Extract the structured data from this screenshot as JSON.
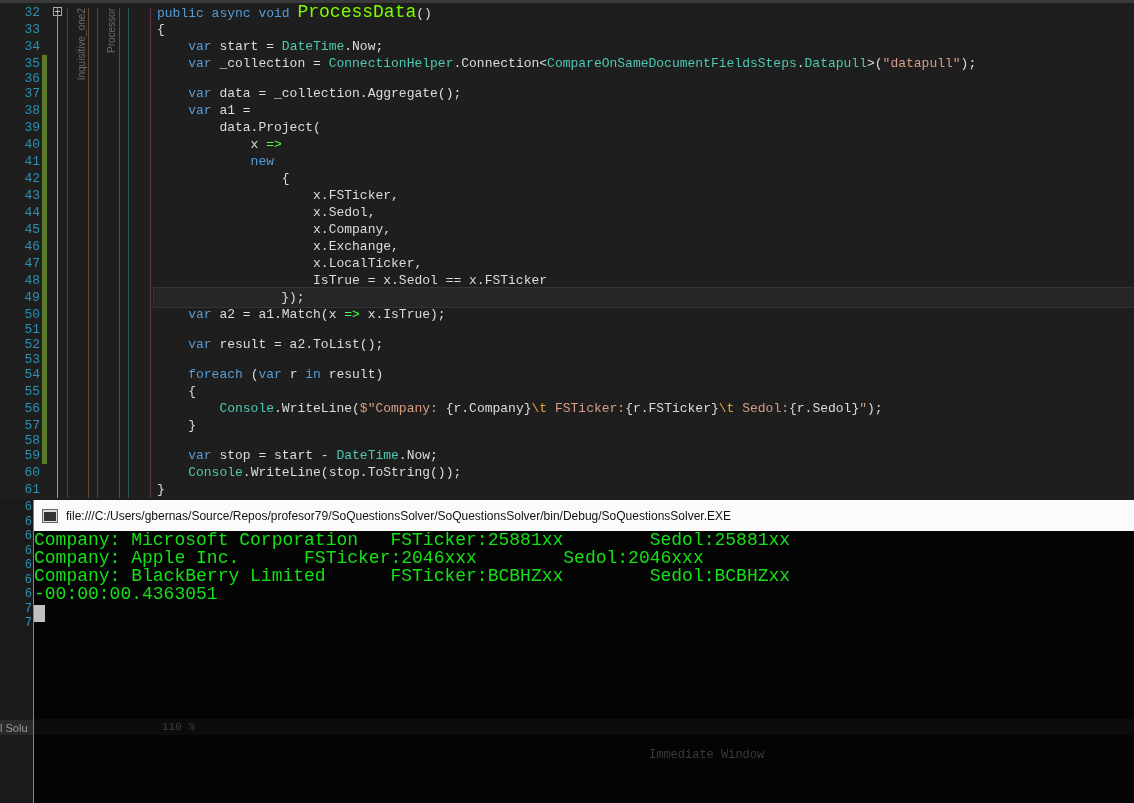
{
  "editor": {
    "margin_labels": [
      "Inquisitive_one2",
      "Processor"
    ],
    "lines": [
      {
        "number": "32",
        "changed": false,
        "current": false,
        "tokens": [
          {
            "kind": "kw",
            "text": "public async void "
          },
          {
            "kind": "method",
            "text": "ProcessData"
          },
          {
            "kind": "plain",
            "text": "()"
          }
        ]
      },
      {
        "number": "33",
        "changed": false,
        "current": false,
        "tokens": [
          {
            "kind": "plain",
            "text": "{"
          }
        ]
      },
      {
        "number": "34",
        "changed": false,
        "current": false,
        "tokens": [
          {
            "kind": "kw",
            "text": "    var"
          },
          {
            "kind": "plain",
            "text": " start = "
          },
          {
            "kind": "type",
            "text": "DateTime"
          },
          {
            "kind": "plain",
            "text": ".Now;"
          }
        ]
      },
      {
        "number": "35",
        "changed": true,
        "current": false,
        "tokens": [
          {
            "kind": "kw",
            "text": "    var"
          },
          {
            "kind": "plain",
            "text": " _collection = "
          },
          {
            "kind": "type",
            "text": "ConnectionHelper"
          },
          {
            "kind": "plain",
            "text": ".Connection<"
          },
          {
            "kind": "type",
            "text": "CompareOnSameDocumentFieldsSteps"
          },
          {
            "kind": "plain",
            "text": "."
          },
          {
            "kind": "type",
            "text": "Datapull"
          },
          {
            "kind": "plain",
            "text": ">("
          },
          {
            "kind": "string",
            "text": "\"datapull\""
          },
          {
            "kind": "plain",
            "text": ");"
          }
        ]
      },
      {
        "number": "36",
        "changed": true,
        "current": false
      },
      {
        "number": "37",
        "changed": true,
        "current": false,
        "tokens": [
          {
            "kind": "kw",
            "text": "    var"
          },
          {
            "kind": "plain",
            "text": " data = _collection.Aggregate();"
          }
        ]
      },
      {
        "number": "38",
        "changed": true,
        "current": false,
        "tokens": [
          {
            "kind": "kw",
            "text": "    var"
          },
          {
            "kind": "plain",
            "text": " a1 ="
          }
        ]
      },
      {
        "number": "39",
        "changed": true,
        "current": false,
        "tokens": [
          {
            "kind": "plain",
            "text": "        data.Project("
          }
        ]
      },
      {
        "number": "40",
        "changed": true,
        "current": false,
        "tokens": [
          {
            "kind": "plain",
            "text": "            x "
          },
          {
            "kind": "op",
            "text": "=>"
          }
        ]
      },
      {
        "number": "41",
        "changed": true,
        "current": false,
        "tokens": [
          {
            "kind": "kw",
            "text": "            new"
          }
        ]
      },
      {
        "number": "42",
        "changed": true,
        "current": false,
        "tokens": [
          {
            "kind": "plain",
            "text": "                {"
          }
        ]
      },
      {
        "number": "43",
        "changed": true,
        "current": false,
        "tokens": [
          {
            "kind": "plain",
            "text": "                    x.FSTicker,"
          }
        ]
      },
      {
        "number": "44",
        "changed": true,
        "current": false,
        "tokens": [
          {
            "kind": "plain",
            "text": "                    x.Sedol,"
          }
        ]
      },
      {
        "number": "45",
        "changed": true,
        "current": false,
        "tokens": [
          {
            "kind": "plain",
            "text": "                    x.Company,"
          }
        ]
      },
      {
        "number": "46",
        "changed": true,
        "current": false,
        "tokens": [
          {
            "kind": "plain",
            "text": "                    x.Exchange,"
          }
        ]
      },
      {
        "number": "47",
        "changed": true,
        "current": false,
        "tokens": [
          {
            "kind": "plain",
            "text": "                    x.LocalTicker,"
          }
        ]
      },
      {
        "number": "48",
        "changed": true,
        "current": false,
        "tokens": [
          {
            "kind": "plain",
            "text": "                    IsTrue = x.Sedol == x.FSTicker"
          }
        ]
      },
      {
        "number": "49",
        "changed": true,
        "current": true,
        "tokens": [
          {
            "kind": "plain",
            "text": "                });"
          }
        ]
      },
      {
        "number": "50",
        "changed": true,
        "current": false,
        "tokens": [
          {
            "kind": "kw",
            "text": "    var"
          },
          {
            "kind": "plain",
            "text": " a2 = a1.Match(x "
          },
          {
            "kind": "op",
            "text": "=>"
          },
          {
            "kind": "plain",
            "text": " x.IsTrue);"
          }
        ]
      },
      {
        "number": "51",
        "changed": true,
        "current": false
      },
      {
        "number": "52",
        "changed": true,
        "current": false,
        "tokens": [
          {
            "kind": "kw",
            "text": "    var"
          },
          {
            "kind": "plain",
            "text": " result = a2.ToList();"
          }
        ]
      },
      {
        "number": "53",
        "changed": true,
        "current": false
      },
      {
        "number": "54",
        "changed": true,
        "current": false,
        "tokens": [
          {
            "kind": "kw",
            "text": "    foreach"
          },
          {
            "kind": "plain",
            "text": " ("
          },
          {
            "kind": "kw",
            "text": "var"
          },
          {
            "kind": "plain",
            "text": " r "
          },
          {
            "kind": "kw",
            "text": "in"
          },
          {
            "kind": "plain",
            "text": " result)"
          }
        ]
      },
      {
        "number": "55",
        "changed": true,
        "current": false,
        "tokens": [
          {
            "kind": "plain",
            "text": "    {"
          }
        ]
      },
      {
        "number": "56",
        "changed": true,
        "current": false,
        "tokens": [
          {
            "kind": "type",
            "text": "        Console"
          },
          {
            "kind": "plain",
            "text": ".WriteLine("
          },
          {
            "kind": "string",
            "text": "$\"Company: "
          },
          {
            "kind": "plain",
            "text": "{r.Company}"
          },
          {
            "kind": "esc",
            "text": "\\t"
          },
          {
            "kind": "string",
            "text": " FSTicker:"
          },
          {
            "kind": "plain",
            "text": "{r.FSTicker}"
          },
          {
            "kind": "esc",
            "text": "\\t"
          },
          {
            "kind": "string",
            "text": " Sedol:"
          },
          {
            "kind": "plain",
            "text": "{r.Sedol}"
          },
          {
            "kind": "string",
            "text": "\""
          },
          {
            "kind": "plain",
            "text": ");"
          }
        ]
      },
      {
        "number": "57",
        "changed": true,
        "current": false,
        "tokens": [
          {
            "kind": "plain",
            "text": "    }"
          }
        ]
      },
      {
        "number": "58",
        "changed": true,
        "current": false
      },
      {
        "number": "59",
        "changed": true,
        "current": false,
        "tokens": [
          {
            "kind": "kw",
            "text": "    var"
          },
          {
            "kind": "plain",
            "text": " stop = start - "
          },
          {
            "kind": "type",
            "text": "DateTime"
          },
          {
            "kind": "plain",
            "text": ".Now;"
          }
        ]
      },
      {
        "number": "60",
        "changed": false,
        "current": false,
        "tokens": [
          {
            "kind": "type",
            "text": "    Console"
          },
          {
            "kind": "plain",
            "text": ".WriteLine(stop.ToString());"
          }
        ]
      },
      {
        "number": "61",
        "changed": false,
        "current": false,
        "tokens": [
          {
            "kind": "plain",
            "text": "}"
          }
        ]
      }
    ]
  },
  "hidden_line_numbers": [
    "6",
    "6",
    "6",
    "6",
    "6",
    "6",
    "6",
    "7",
    "7"
  ],
  "left_panel_tab": "l Solu",
  "console": {
    "title": "file:///C:/Users/gbernas/Source/Repos/profesor79/SoQuestionsSolver/SoQuestionsSolver/bin/Debug/SoQuestionsSolver.EXE",
    "output": [
      "Company: Microsoft Corporation   FSTicker:25881xx        Sedol:25881xx",
      "Company: Apple Inc.      FSTicker:2046xxx        Sedol:2046xxx",
      "Company: BlackBerry Limited      FSTicker:BCBHZxx        Sedol:BCBHZxx",
      "-00:00:00.4363051"
    ],
    "zoom_level": "110 %",
    "panel_title": "Immediate Window"
  }
}
